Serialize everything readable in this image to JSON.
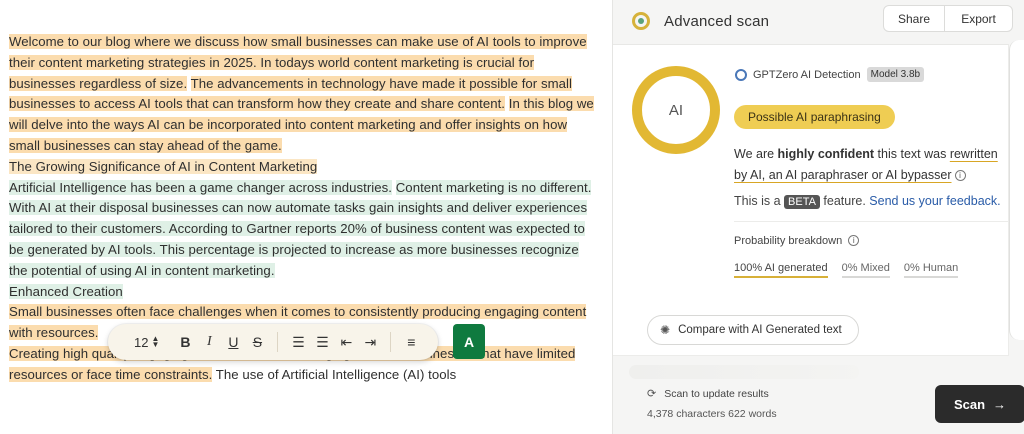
{
  "editor": {
    "segments": [
      {
        "kind": "ai",
        "text": "Welcome to our blog where we discuss how small businesses can make use of AI tools to improve their content marketing strategies in 2025. In todays world content marketing is crucial for businesses regardless of size."
      },
      {
        "kind": "plain",
        "text": " "
      },
      {
        "kind": "ai",
        "text": "The advancements in technology have made it possible for small businesses to access AI tools that can transform how they create and share content."
      },
      {
        "kind": "plain",
        "text": " "
      },
      {
        "kind": "ai",
        "text": "In this blog we will delve into the ways AI can be incorporated into content marketing and offer insights on how small businesses can stay ahead of the game."
      },
      {
        "kind": "break",
        "text": ""
      },
      {
        "kind": "ai2",
        "text": "The Growing Significance of AI in Content Marketing"
      },
      {
        "kind": "break",
        "text": ""
      },
      {
        "kind": "human",
        "text": "Artificial Intelligence has been a game changer across industries."
      },
      {
        "kind": "plain",
        "text": " "
      },
      {
        "kind": "human",
        "text": "Content marketing is no different. With AI at their disposal businesses can now automate tasks gain insights and deliver experiences tailored to their customers. According to Gartner reports 20% of business content was expected to be generated by AI tools. This percentage is projected to increase as more businesses recognize the potential of using AI in content marketing."
      },
      {
        "kind": "break",
        "text": ""
      },
      {
        "kind": "human",
        "text": "Enhanced Creation"
      },
      {
        "kind": "break",
        "text": ""
      },
      {
        "kind": "ai",
        "text": "Small businesses often face challenges when it comes to consistently producing engaging content with resources."
      },
      {
        "kind": "break",
        "text": ""
      },
      {
        "kind": "ai",
        "text": "Creating high quality engaging content can be challenging for small businesses that have limited resources or face time constraints."
      },
      {
        "kind": "plain",
        "text": " The use of Artificial Intelligence (AI) tools"
      }
    ],
    "toolbar": {
      "font_size": "12",
      "bold": "B",
      "italic": "I",
      "underline": "U",
      "strike": "S",
      "ordered_list": "☰",
      "bullet_list": "☰",
      "outdent": "⇤",
      "indent": "⇥",
      "align": "≡"
    },
    "assistant_button": "A"
  },
  "panel": {
    "title": "Advanced scan",
    "share_label": "Share",
    "export_label": "Export",
    "donut_label": "AI",
    "detector_name": "GPTZero AI Detection",
    "model_badge": "Model 3.8b",
    "verdict_pill": "Possible AI paraphrasing",
    "confidence_pre": "We are ",
    "confidence_bold": "highly confident",
    "confidence_mid": " this text was ",
    "confidence_underlined": "rewritten by AI, an AI paraphraser or AI bypasser",
    "beta_pre": "This is a ",
    "beta_badge": "BETA",
    "beta_post": " feature. ",
    "feedback_link": "Send us your feedback.",
    "probability_label": "Probability breakdown",
    "probabilities": {
      "ai": "100% AI generated",
      "mixed": "0% Mixed",
      "human": "0% Human"
    },
    "compare_label": "Compare with AI Generated text",
    "update_label": "Scan to update results",
    "counts_label": "4,378 characters 622 words",
    "scan_label": "Scan"
  },
  "colors": {
    "ai_highlight": "#fbdcae",
    "human_highlight": "#dff0e6",
    "accent_yellow": "#e2b833",
    "assistant_green": "#0f7a3f",
    "scan_button": "#2b2b2b",
    "link_blue": "#2a5ca8"
  },
  "icons": {
    "logo": "gptzero-logo-icon",
    "info": "info-icon",
    "compare": "gear-icon",
    "sync": "sync-icon",
    "arrow": "arrow-right-icon"
  }
}
